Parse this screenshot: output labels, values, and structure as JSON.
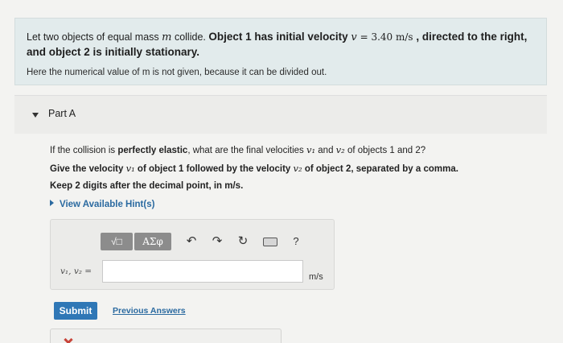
{
  "intro": {
    "t1": "Let two objects of equal mass ",
    "m": "m",
    "t2": " collide. ",
    "t3": "Object 1 has initial velocity ",
    "v": "v",
    "eq": " = 3.40 ",
    "unit": "m/s",
    "t4": " , directed to the right, and object 2 is initially stationary.",
    "note": "Here the numerical value of m is not given, because it can be divided out."
  },
  "part": {
    "title": "Part A"
  },
  "question": {
    "l1a": "If the collision is ",
    "l1b": "perfectly elastic",
    "l1c": ", what are the final velocities ",
    "v1": "v₁",
    "and": " and ",
    "v2": "v₂",
    "l1d": " of objects 1 and 2?",
    "l2a": "Give the velocity ",
    "l2b": " of object 1 followed by the velocity ",
    "l2c": " of object 2, separated by a comma.",
    "l3": "Keep 2 digits after the decimal point, in m/s.",
    "hint": "View Available Hint(s)"
  },
  "toolbar": {
    "templates_label": "√□",
    "greek_label": "AΣφ",
    "undo_icon": "undo-icon",
    "redo_icon": "redo-icon",
    "reset_icon": "reset-icon",
    "keyboard_icon": "keyboard-icon",
    "help_label": "?"
  },
  "answer": {
    "label": "v₁, v₂ =",
    "value": "",
    "unit": "m/s"
  },
  "actions": {
    "submit_label": "Submit",
    "previous_label": "Previous Answers"
  }
}
